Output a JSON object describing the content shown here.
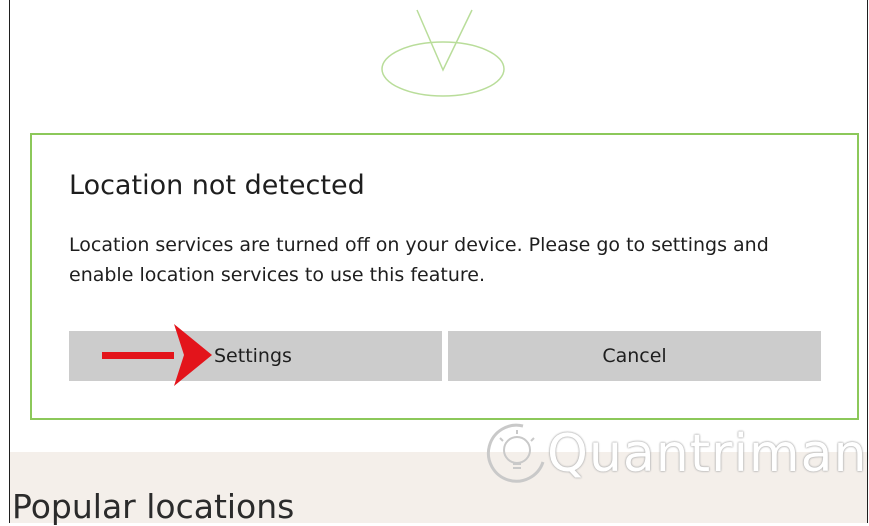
{
  "dialog": {
    "title": "Location not detected",
    "message": "Location services are turned off on your device. Please go to settings and enable location services to use this feature.",
    "buttons": {
      "settings_label": "Settings",
      "cancel_label": "Cancel"
    }
  },
  "page": {
    "section_heading": "Popular locations"
  },
  "watermark": {
    "text": "Quantrimang"
  },
  "icons": {
    "location_pin": "map-pin-icon",
    "annotation_arrow": "red-arrow-icon",
    "watermark_logo": "lightbulb-icon"
  },
  "colors": {
    "dialog_border": "#8cc85a",
    "button_background": "#cccccc",
    "arrow": "#e3141b",
    "bottom_band": "#f4efea"
  }
}
